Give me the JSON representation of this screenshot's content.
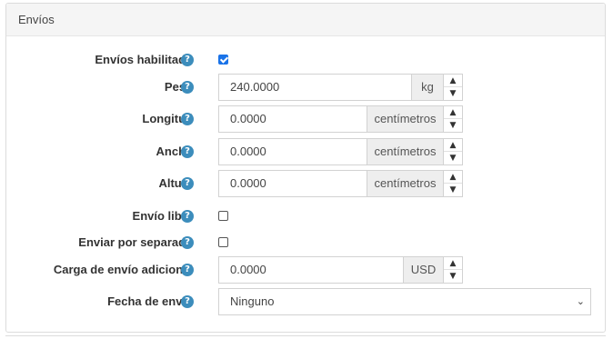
{
  "panel": {
    "title": "Envíos"
  },
  "fields": {
    "shipping_enabled": {
      "label": "Envíos habilitado",
      "checked": true
    },
    "weight": {
      "label": "Peso",
      "value": "240.0000",
      "unit": "kg"
    },
    "length": {
      "label": "Longitud",
      "value": "0.0000",
      "unit": "centímetros"
    },
    "width": {
      "label": "Ancho",
      "value": "0.0000",
      "unit": "centímetros"
    },
    "height": {
      "label": "Altura",
      "value": "0.0000",
      "unit": "centímetros"
    },
    "free_shipping": {
      "label": "Envío libre",
      "checked": false
    },
    "ship_separately": {
      "label": "Enviar por separado",
      "checked": false
    },
    "additional_charge": {
      "label": "Carga de envío adicional",
      "value": "0.0000",
      "unit": "USD"
    },
    "delivery_date": {
      "label": "Fecha de envío",
      "selected": "Ninguno"
    }
  },
  "icons": {
    "help": "question-circle-icon",
    "spin_up": "chevron-up-icon",
    "spin_down": "chevron-down-icon",
    "select": "chevron-down-icon"
  },
  "glyphs": {
    "help": "?",
    "up": "▲",
    "down": "▼",
    "select": "⌄"
  },
  "colors": {
    "help_icon": "#3c8dbc",
    "checkbox_checked": "#1a73e8"
  }
}
